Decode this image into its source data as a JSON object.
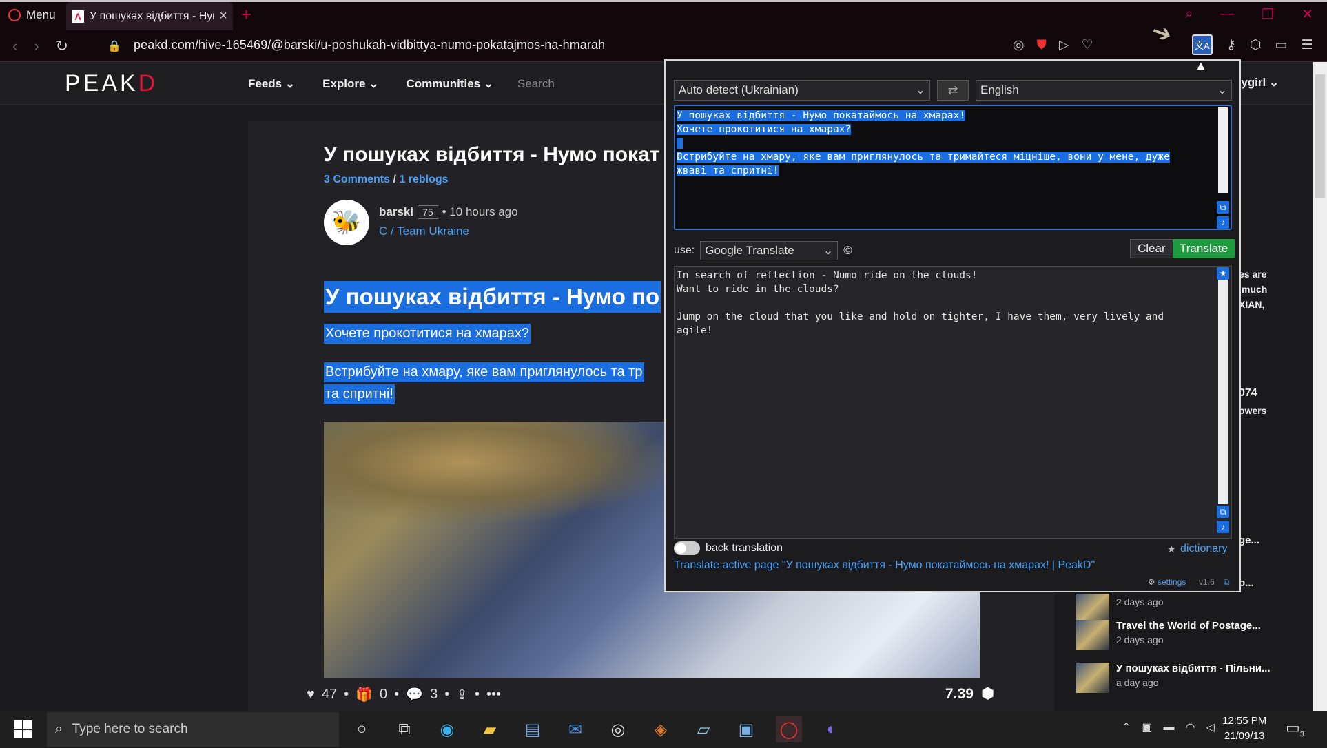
{
  "browser": {
    "menu_label": "Menu",
    "tab_title": "У пошуках відбиття - Нумо",
    "url": "peakd.com/hive-165469/@barski/u-poshukah-vidbittya-numo-pokatajmos-na-hmarah"
  },
  "site": {
    "logo_main": "PEAK",
    "logo_accent": "D",
    "nav": [
      "Feeds",
      "Explore",
      "Communities"
    ],
    "search_placeholder": "Search",
    "user_fragment": "ttygirl"
  },
  "post": {
    "title": "У пошуках відбиття - Нумо покат",
    "comments_link": "3 Comments",
    "reblogs_link": "1 reblogs",
    "author": "barski",
    "reputation": "75",
    "time": "• 10 hours ago",
    "community": "C / Team Ukraine",
    "body_heading": "У пошуках відбиття - Нумо по",
    "body_p1": "Хочете прокотитися на хмарах?",
    "body_p2a": "Встрибуйте на хмару, яке вам приглянулось та тр",
    "body_p2b": "та спритні!",
    "votes": "47",
    "gifts": "0",
    "comments": "3",
    "payout": "7.39"
  },
  "sidebar": {
    "frag_lines": [
      "es are",
      "much",
      "XIAN,",
      "074",
      "owers",
      "ge...",
      "o..."
    ],
    "items": [
      {
        "title": "",
        "time": "2 days ago"
      },
      {
        "title": "Travel the World of Postage...",
        "time": "2 days ago"
      },
      {
        "title": "У пошуках відбиття - Пільни...",
        "time": "a day ago"
      }
    ]
  },
  "translator": {
    "source_lang": "Auto detect (Ukrainian)",
    "target_lang": "English",
    "source_text_lines": [
      "У пошуках відбиття - Нумо покатаймось на хмарах!",
      "Хочете прокотитися на хмарах?",
      " ",
      "Встрибуйте на хмару, яке вам приглянулось та тримайтеся міцніше, вони у мене, дуже",
      "жваві та спритні!"
    ],
    "use_label": "use:",
    "engine": "Google Translate",
    "copyright": "©",
    "clear_label": "Clear",
    "translate_label": "Translate",
    "output_text": "In search of reflection - Numo ride on the clouds!\nWant to ride in the clouds?\n\nJump on the cloud that you like and hold on tighter, I have them, very lively and\nagile!",
    "back_translation_label": "back translation",
    "dictionary_label": "dictionary",
    "page_link": "Translate active page \"У пошуках відбиття - Нумо покатаймось на хмарах! | PeakD\"",
    "settings_label": "settings",
    "version": "v1.6"
  },
  "taskbar": {
    "search_placeholder": "Type here to search",
    "time": "12:55 PM",
    "date": "21/09/13",
    "notif_count": "3"
  }
}
